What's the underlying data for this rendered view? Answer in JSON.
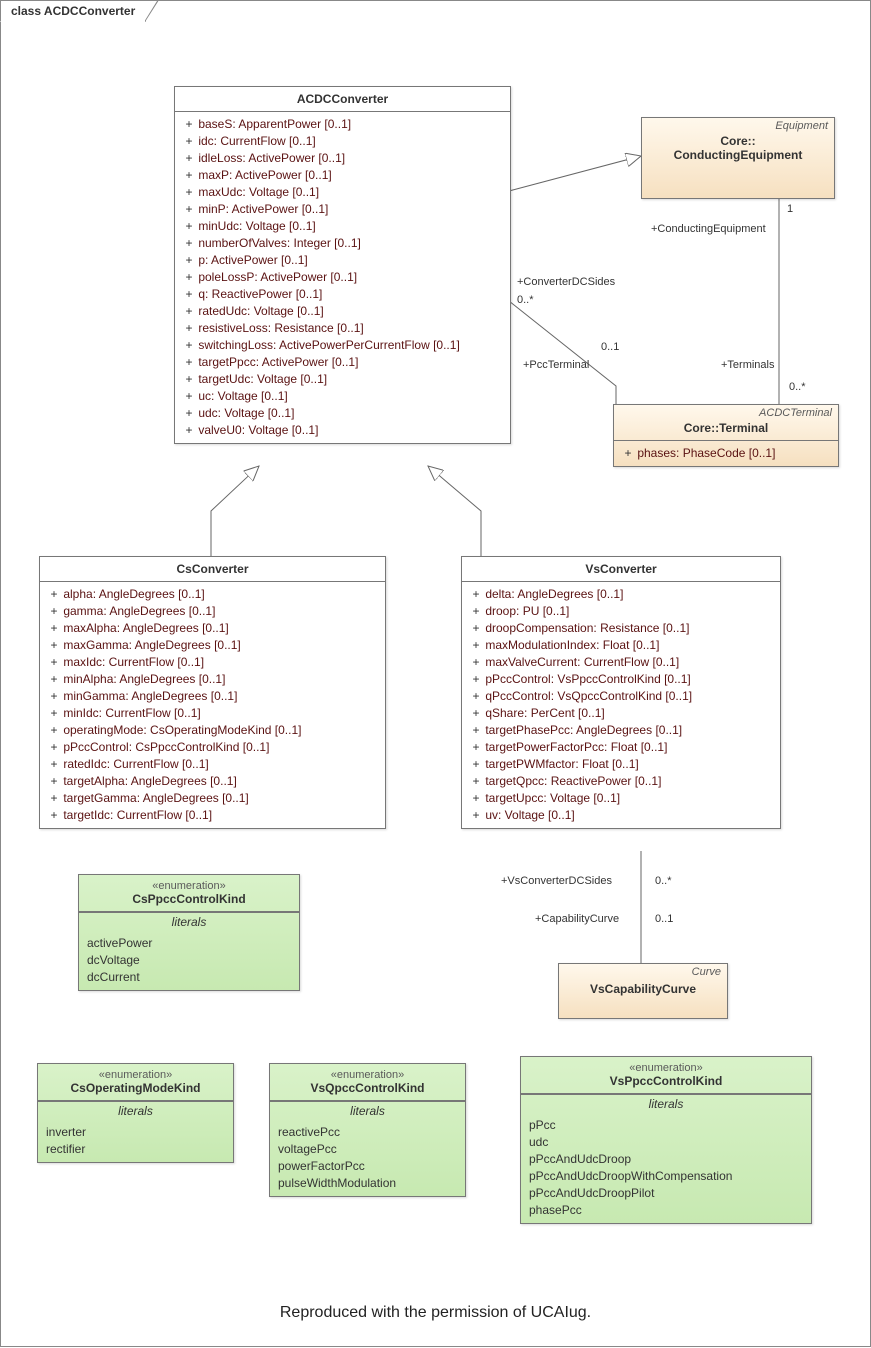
{
  "frame_title": "class ACDCConverter",
  "footer": "Reproduced with the permission of UCAIug.",
  "classes": {
    "ACDCConverter": {
      "name": "ACDCConverter",
      "attrs": [
        "baseS: ApparentPower [0..1]",
        "idc: CurrentFlow [0..1]",
        "idleLoss: ActivePower [0..1]",
        "maxP: ActivePower [0..1]",
        "maxUdc: Voltage [0..1]",
        "minP: ActivePower [0..1]",
        "minUdc: Voltage [0..1]",
        "numberOfValves: Integer [0..1]",
        "p: ActivePower [0..1]",
        "poleLossP: ActivePower [0..1]",
        "q: ReactivePower [0..1]",
        "ratedUdc: Voltage [0..1]",
        "resistiveLoss: Resistance [0..1]",
        "switchingLoss: ActivePowerPerCurrentFlow [0..1]",
        "targetPpcc: ActivePower [0..1]",
        "targetUdc: Voltage [0..1]",
        "uc: Voltage [0..1]",
        "udc: Voltage [0..1]",
        "valveU0: Voltage [0..1]"
      ]
    },
    "ConductingEquipment": {
      "topright": "Equipment",
      "name": "Core::\nConductingEquipment"
    },
    "Terminal": {
      "topright": "ACDCTerminal",
      "name": "Core::Terminal",
      "attrs": [
        "phases: PhaseCode [0..1]"
      ]
    },
    "CsConverter": {
      "name": "CsConverter",
      "attrs": [
        "alpha: AngleDegrees [0..1]",
        "gamma: AngleDegrees [0..1]",
        "maxAlpha: AngleDegrees [0..1]",
        "maxGamma: AngleDegrees [0..1]",
        "maxIdc: CurrentFlow [0..1]",
        "minAlpha: AngleDegrees [0..1]",
        "minGamma: AngleDegrees [0..1]",
        "minIdc: CurrentFlow [0..1]",
        "operatingMode: CsOperatingModeKind [0..1]",
        "pPccControl: CsPpccControlKind [0..1]",
        "ratedIdc: CurrentFlow [0..1]",
        "targetAlpha: AngleDegrees [0..1]",
        "targetGamma: AngleDegrees [0..1]",
        "targetIdc: CurrentFlow [0..1]"
      ]
    },
    "VsConverter": {
      "name": "VsConverter",
      "attrs": [
        "delta: AngleDegrees [0..1]",
        "droop: PU [0..1]",
        "droopCompensation: Resistance [0..1]",
        "maxModulationIndex: Float [0..1]",
        "maxValveCurrent: CurrentFlow [0..1]",
        "pPccControl: VsPpccControlKind [0..1]",
        "qPccControl: VsQpccControlKind [0..1]",
        "qShare: PerCent [0..1]",
        "targetPhasePcc: AngleDegrees [0..1]",
        "targetPowerFactorPcc: Float [0..1]",
        "targetPWMfactor: Float [0..1]",
        "targetQpcc: ReactivePower [0..1]",
        "targetUpcc: Voltage [0..1]",
        "uv: Voltage [0..1]"
      ]
    },
    "VsCapabilityCurve": {
      "topright": "Curve",
      "name": "VsCapabilityCurve"
    },
    "CsPpccControlKind": {
      "stereo": "«enumeration»",
      "name": "CsPpccControlKind",
      "section": "literals",
      "literals": [
        "activePower",
        "dcVoltage",
        "dcCurrent"
      ]
    },
    "CsOperatingModeKind": {
      "stereo": "«enumeration»",
      "name": "CsOperatingModeKind",
      "section": "literals",
      "literals": [
        "inverter",
        "rectifier"
      ]
    },
    "VsQpccControlKind": {
      "stereo": "«enumeration»",
      "name": "VsQpccControlKind",
      "section": "literals",
      "literals": [
        "reactivePcc",
        "voltagePcc",
        "powerFactorPcc",
        "pulseWidthModulation"
      ]
    },
    "VsPpccControlKind": {
      "stereo": "«enumeration»",
      "name": "VsPpccControlKind",
      "section": "literals",
      "literals": [
        "pPcc",
        "udc",
        "pPccAndUdcDroop",
        "pPccAndUdcDroopWithCompensation",
        "pPccAndUdcDroopPilot",
        "phasePcc"
      ]
    }
  },
  "assoc": {
    "ConverterDCSides": "+ConverterDCSides",
    "ConverterDCSides_mult": "0..*",
    "PccTerminal": "+PccTerminal",
    "PccTerminal_mult": "0..1",
    "ConductingEquipment_role": "+ConductingEquipment",
    "ConductingEquipment_mult": "1",
    "Terminals_role": "+Terminals",
    "Terminals_mult": "0..*",
    "VsConverterDCSides": "+VsConverterDCSides",
    "VsConverterDCSides_mult": "0..*",
    "CapabilityCurve": "+CapabilityCurve",
    "CapabilityCurve_mult": "0..1"
  }
}
